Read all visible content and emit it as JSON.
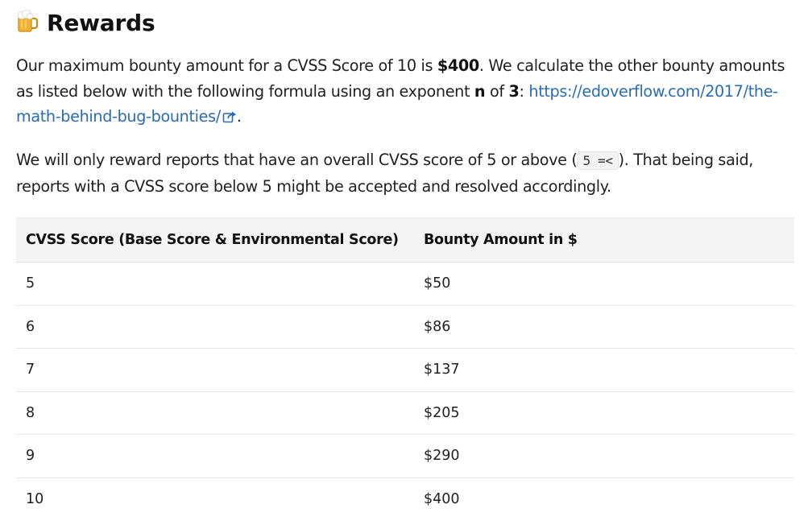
{
  "section": {
    "icon": "beer-mug-icon",
    "title": "Rewards"
  },
  "intro": {
    "t1": "Our maximum bounty amount for a CVSS Score of 10 is ",
    "max_amount": "$400",
    "t2": ". We calculate the other bounty amounts as listed below with the following formula using an exponent ",
    "exponent_symbol": "n",
    "t3": " of ",
    "exponent_value": "3",
    "t4": ": ",
    "link_text": "https://edoverflow.com/2017/the-math-behind-bug-bounties/",
    "link_icon": "external-link-icon",
    "t5": "."
  },
  "eligibility": {
    "t1": "We will only reward reports that have an overall CVSS score of 5 or above (",
    "code": "5 =<",
    "t2": "). That being said, reports with a CVSS score below 5 might be accepted and resolved accordingly."
  },
  "table": {
    "headers": [
      "CVSS Score (Base Score & Environmental Score)",
      "Bounty Amount in $"
    ],
    "rows": [
      {
        "score": "5",
        "amount": "$50"
      },
      {
        "score": "6",
        "amount": "$86"
      },
      {
        "score": "7",
        "amount": "$137"
      },
      {
        "score": "8",
        "amount": "$205"
      },
      {
        "score": "9",
        "amount": "$290"
      },
      {
        "score": "10",
        "amount": "$400"
      }
    ]
  }
}
